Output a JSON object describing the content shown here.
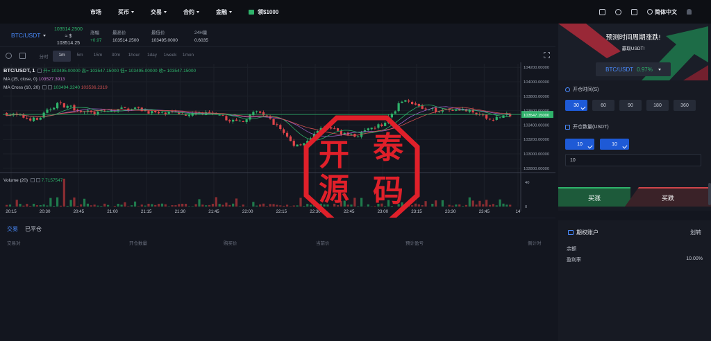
{
  "nav": {
    "items": [
      {
        "label": "市场",
        "caret": false
      },
      {
        "label": "买币",
        "caret": true
      },
      {
        "label": "交易",
        "caret": true
      },
      {
        "label": "合约",
        "caret": true
      },
      {
        "label": "金融",
        "caret": true
      }
    ],
    "promo": "领$1000",
    "language": "简体中文"
  },
  "ticker": {
    "pair": "BTC/USDT",
    "price_top": "103514.2500",
    "price_mid": "≈ $",
    "price_bottom": "103514.25",
    "change_label": "涨幅",
    "change_value": "+0.97",
    "high_label": "最高价",
    "high_value": "103514.2500",
    "low_label": "最低价",
    "low_value": "103495.0000",
    "vol_label": "24H量",
    "vol_value": "0.6035"
  },
  "toolbar": {
    "intervals": [
      "分时",
      "1m",
      "5m",
      "15m",
      "30m",
      "1hour",
      "1day",
      "1week",
      "1mon"
    ],
    "active_interval": "1m"
  },
  "chart_data": {
    "type": "candlestick",
    "symbol": "BTC/USDT, 1",
    "legend": {
      "ohlc": "开= 103495.00000 高= 103547.15000 低= 103495.00000 收= 103547.15000",
      "ma": "MA (15, close, 0)",
      "ma_value": "103527.3913",
      "ma_cross": "MA Cross (10, 20)",
      "ma_cross_a": "103494.3240",
      "ma_cross_b": "103536.2319"
    },
    "y_ticks": [
      "104200.00000",
      "104000.00000",
      "103800.00000",
      "103600.00000",
      "103400.00000",
      "103200.00000",
      "103000.00000",
      "102800.00000"
    ],
    "y_tick_values": [
      104200,
      104000,
      103800,
      103600,
      103400,
      103200,
      103000,
      102800
    ],
    "ylim": [
      102750,
      104250
    ],
    "last_price_label": "103547.15000",
    "last_price": 103547.15,
    "x_ticks": [
      "20:15",
      "20:30",
      "20:45",
      "21:00",
      "21:15",
      "21:30",
      "21:45",
      "22:00",
      "22:15",
      "22:30",
      "22:45",
      "23:00",
      "23:15",
      "23:30",
      "23:45",
      "14"
    ],
    "volume_label": "Volume (20)",
    "volume_value": "7.7157547",
    "volume_ticks": [
      "40",
      "0"
    ],
    "volume_tick_values": [
      40,
      0
    ],
    "volume_ylim": [
      0,
      55
    ]
  },
  "stamp": {
    "chars": [
      "开",
      "泰",
      "源",
      "码"
    ]
  },
  "orders": {
    "tabs": [
      "交易",
      "已平仓"
    ],
    "headers": [
      "交易对",
      "开仓数量",
      "购买价",
      "当前价",
      "预计盈亏",
      "倒计时"
    ]
  },
  "trade_panel": {
    "banner_title": "预测时间周期涨跌!",
    "banner_sub": "赢取USDT!",
    "pair": "BTC/USDT",
    "pair_change": "0.97%",
    "time_label": "开仓时间(S)",
    "times": [
      "30",
      "60",
      "90",
      "180",
      "360"
    ],
    "active_time": "30",
    "amount_label": "开仓数量(USDT)",
    "amounts": [
      "10",
      "10"
    ],
    "amount_input": "10",
    "buy_up": "买涨",
    "buy_down": "买跌"
  },
  "account": {
    "title": "期权账户",
    "transfer": "划转",
    "balance_label": "余额",
    "profit_label": "盈利率",
    "profit_value": "10.00%"
  },
  "colors": {
    "up": "#2fb36b",
    "down": "#e0454a",
    "accent": "#4a8cff",
    "stamp": "#e0202a"
  }
}
